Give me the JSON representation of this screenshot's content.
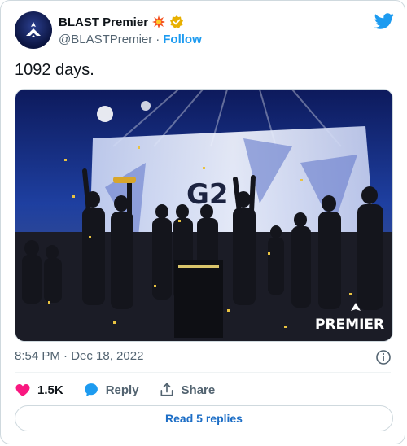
{
  "author": {
    "display_name": "BLAST Premier",
    "handle": "@BLASTPremier",
    "separator": "·",
    "follow_label": "Follow"
  },
  "tweet": {
    "text": "1092 days.",
    "timestamp": "8:54 PM · Dec 18, 2022",
    "media": {
      "overlay_logo_text": "PREMIER",
      "screen_text": "G2"
    }
  },
  "actions": {
    "like_count": "1.5K",
    "reply_label": "Reply",
    "share_label": "Share"
  },
  "replies_button": {
    "label": "Read 5 replies"
  },
  "icons": {
    "avatar": "blast-logo-icon",
    "badge_fire": "explosion-icon",
    "verified": "verified-badge-icon",
    "brand": "twitter-bird-icon",
    "info": "info-icon",
    "like": "heart-icon",
    "reply": "speech-bubble-icon",
    "share": "share-icon"
  },
  "colors": {
    "accent": "#1d9bf0",
    "like": "#f91880",
    "verified": "#e8b000",
    "text_secondary": "#536471",
    "border": "#cfd9de"
  }
}
